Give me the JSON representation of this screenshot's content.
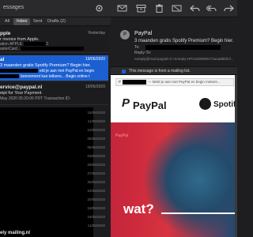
{
  "window": {
    "title": "essages"
  },
  "toolbar": {
    "icons": [
      "gear-icon",
      "envelope-icon",
      "archive-icon",
      "trash-icon",
      "junk-icon",
      "reply-icon",
      "reply-all-icon",
      "forward-icon",
      "flag-icon"
    ]
  },
  "tabs": [
    {
      "label": "All"
    },
    {
      "label": "Inbox"
    },
    {
      "label": "Sent"
    },
    {
      "label": "Drafts (2)"
    }
  ],
  "list": {
    "messages": [
      {
        "sender": "pple",
        "date": "Yesterday",
        "subject": "r invoice from Apple.",
        "preview": "ation APPLE ID          BILLED TO",
        "preview2": "asterCard ..."
      },
      {
        "sender": "al",
        "date": "19/06/2020",
        "subject": "3 maanden gratis Spotify Premium? Begin hier.",
        "preview": "eld je aan met PayPal en begin",
        "preview2": "bonnement kan telkens... Begin online t",
        "selected": true
      },
      {
        "sender": "ervice@paypal.nl",
        "date": "19/06/2020",
        "subject": "eipt for Your Payment",
        "preview": "May 2020 05:20:06 PDT Transaction ID:"
      }
    ],
    "dates": [
      "15/06/2020",
      "11/06/2020",
      "10/06/2020",
      "08/06/2020",
      "05/06/2020",
      "03/06/2020",
      "29/05/2020",
      "27/05/2020",
      "25/05/2020",
      "22/05/2020",
      "20/05/2020",
      "18/05/2020",
      "15/05/2020",
      "11/05/2020"
    ],
    "footer_sender": "ely mailing.nl"
  },
  "email": {
    "from": "PayPal",
    "subject": "3 maanden gratis Spotify Premium? Begin hier.",
    "to_label": "To:",
    "reply_to_label": "Reply-To:",
    "refer": "noreply@mail.paypal.nl <noreply-HP2s4000001T2a1a8bbhcf...",
    "mailing_notice": "This message is from a mailing list.",
    "preheader_prefix": "P",
    "preheader": "— Meld je aan met PayPal en begin meteen...",
    "paypal_brand": "PayPal",
    "spotify_brand": "Spotify",
    "hero_word": "wat?",
    "red_tag": "PayPal"
  }
}
